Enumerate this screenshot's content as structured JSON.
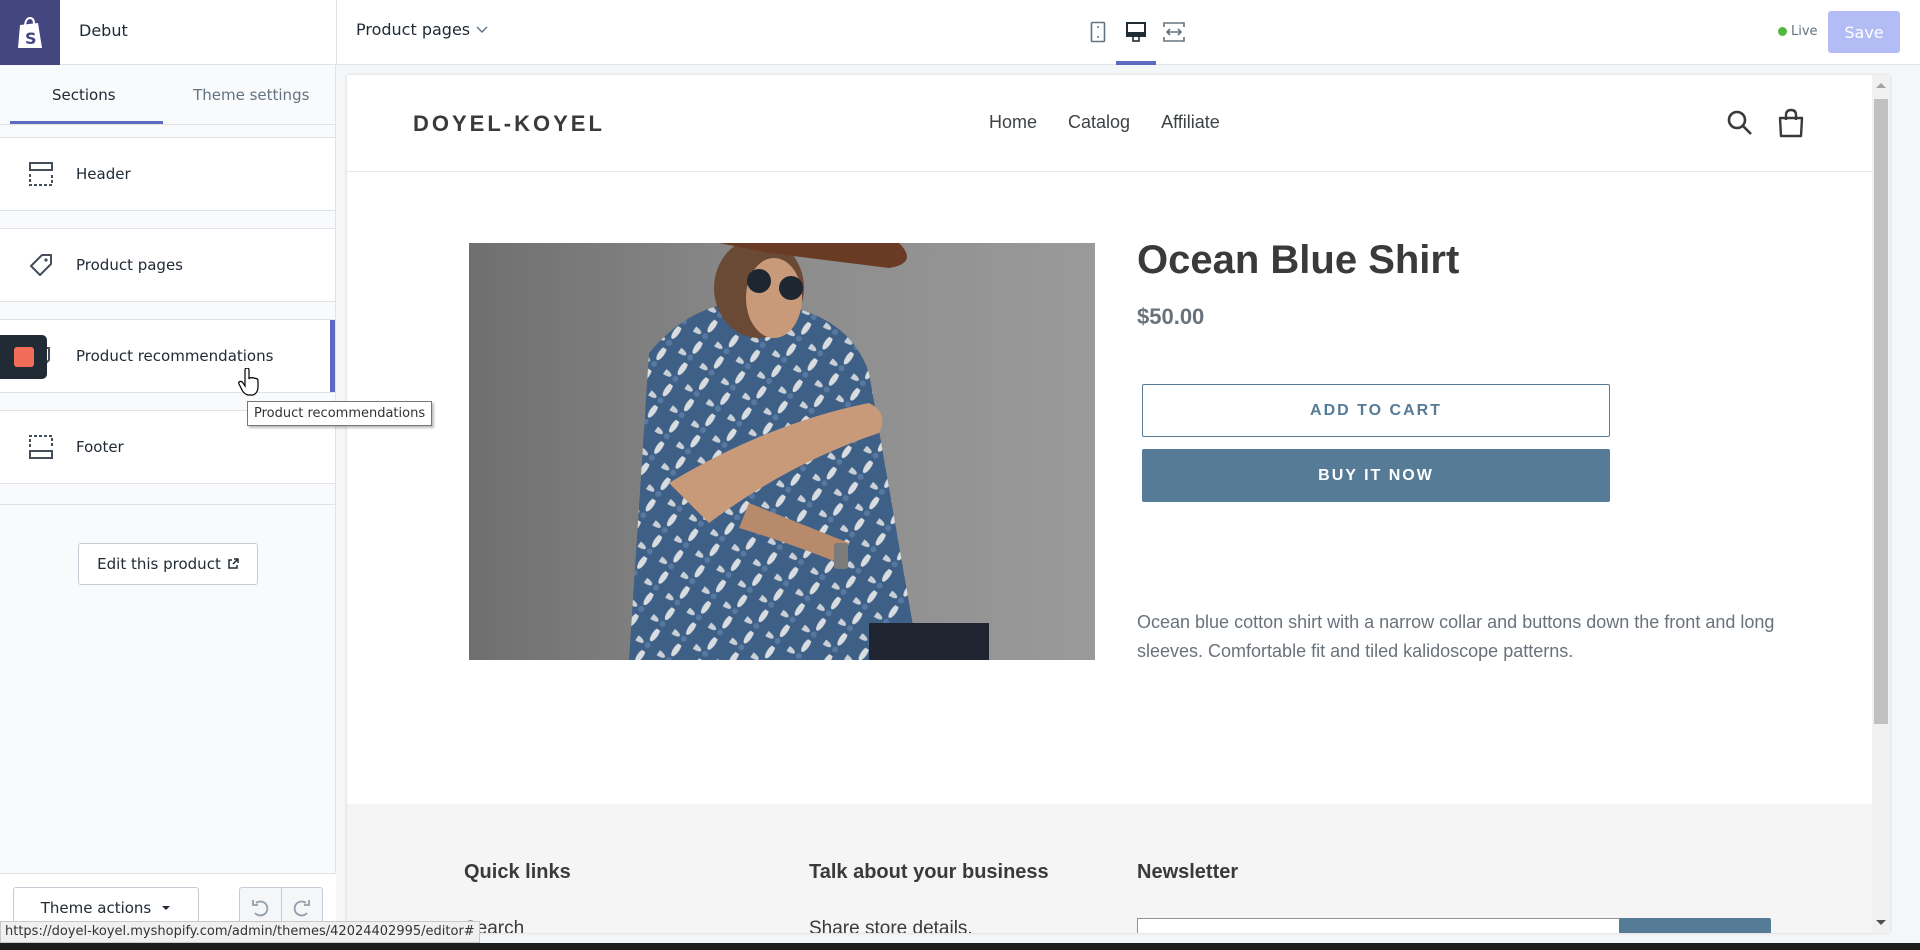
{
  "topbar": {
    "theme_name": "Debut",
    "page_select": "Product pages",
    "devices": [
      "mobile",
      "desktop",
      "fullscreen"
    ],
    "active_device": "desktop",
    "live_label": "Live",
    "save_label": "Save",
    "colors": {
      "logo_bg": "#43467f",
      "accent": "#5c6ac4",
      "save_disabled": "#b3bcf5",
      "live_dot": "#50b83c"
    }
  },
  "sidebar": {
    "tabs": [
      {
        "label": "Sections",
        "active": true
      },
      {
        "label": "Theme settings",
        "active": false
      }
    ],
    "sections": [
      {
        "label": "Header",
        "icon": "header-layout-icon"
      },
      {
        "label": "Product pages",
        "icon": "tag-icon"
      },
      {
        "label": "Product recommendations",
        "icon": "product-icon",
        "hovered": true
      },
      {
        "label": "Footer",
        "icon": "footer-layout-icon"
      }
    ],
    "edit_product_label": "Edit this product",
    "theme_actions_label": "Theme actions",
    "tooltip": "Product recommendations"
  },
  "status_bar": {
    "url": "https://doyel-koyel.myshopify.com/admin/themes/42024402995/editor#"
  },
  "preview": {
    "brand": "DOYEL-KOYEL",
    "nav": [
      "Home",
      "Catalog",
      "Affiliate"
    ],
    "product": {
      "title": "Ocean Blue Shirt",
      "price": "$50.00",
      "add_to_cart": "ADD TO CART",
      "buy_now": "BUY IT NOW",
      "description": "Ocean blue cotton shirt with a narrow collar and buttons down the front and long sleeves. Comfortable fit and tiled kalidoscope patterns.",
      "image_alt": "Man in blue patterned shirt leaning on concrete wall"
    },
    "footer": {
      "columns": [
        {
          "heading": "Quick links",
          "text": "Search"
        },
        {
          "heading": "Talk about your business",
          "text": "Share store details,"
        },
        {
          "heading": "Newsletter",
          "text": ""
        }
      ]
    },
    "colors": {
      "button": "#557b97",
      "text": "#3a3a3a",
      "muted": "#69727b",
      "footer_bg": "#f5f5f5"
    }
  }
}
